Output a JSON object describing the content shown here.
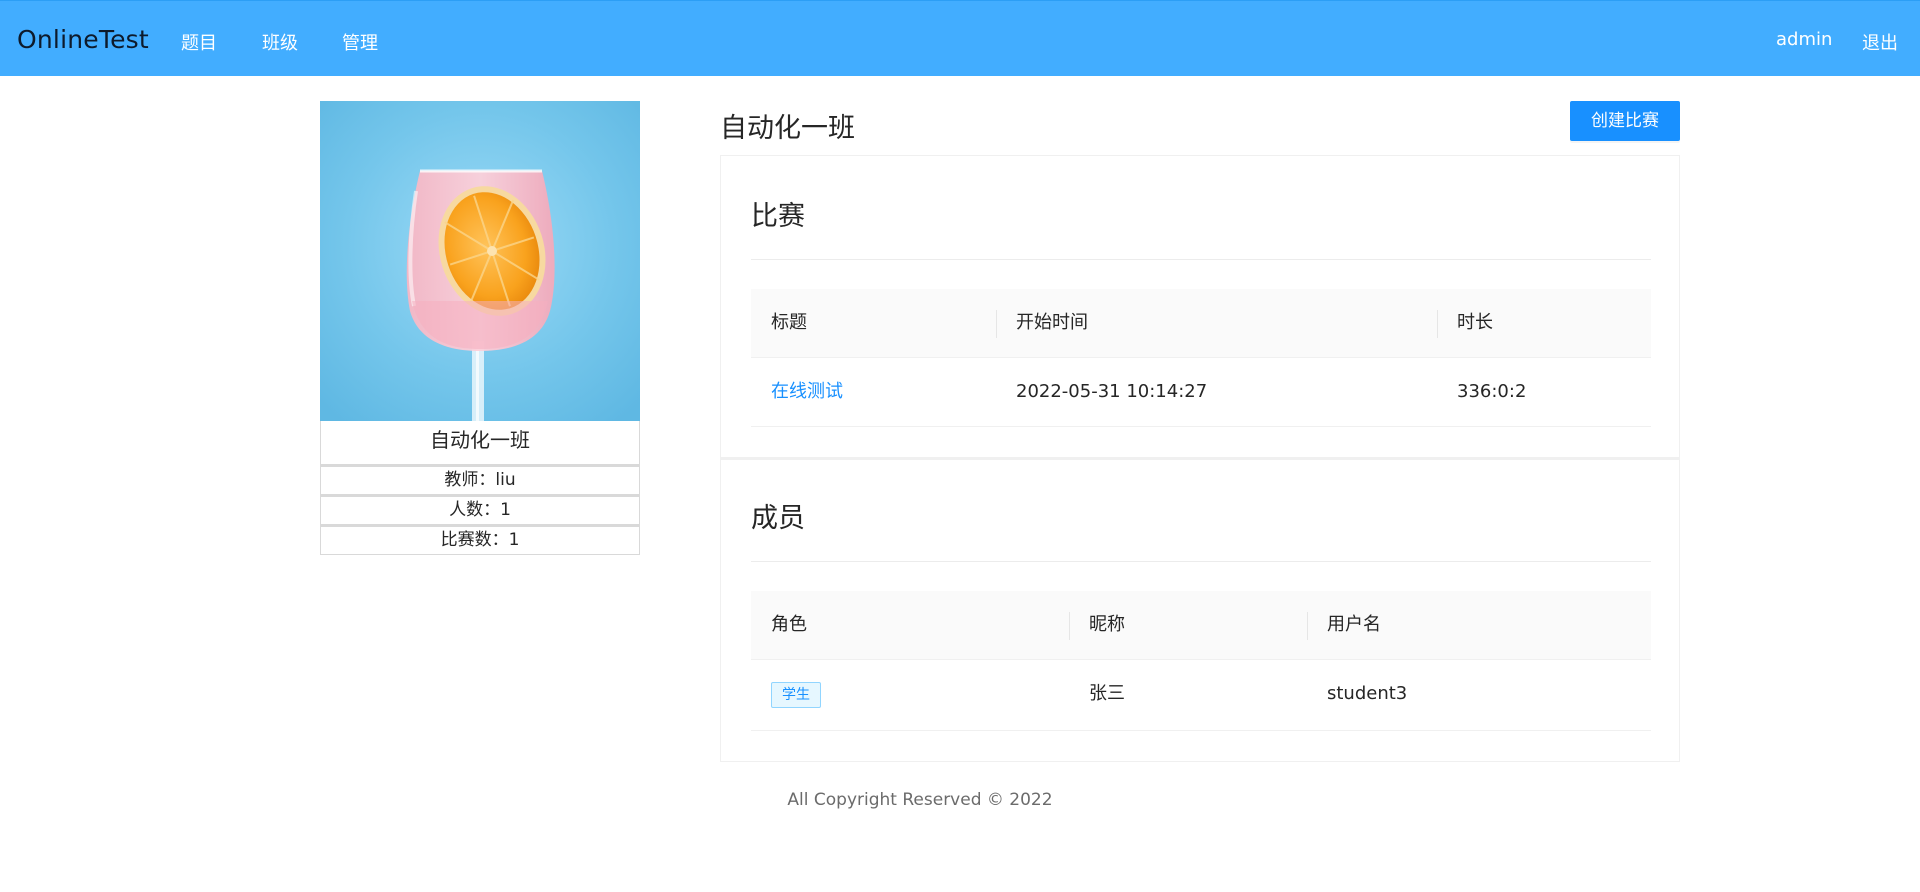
{
  "nav": {
    "brand": "OnlineTest",
    "items": [
      {
        "label": "题目"
      },
      {
        "label": "班级"
      },
      {
        "label": "管理"
      }
    ],
    "user": "admin",
    "logout": "退出"
  },
  "class_card": {
    "name": "自动化一班",
    "teacher_label": "教师：",
    "teacher": "liu",
    "members_label": "人数：",
    "members": "1",
    "contests_label": "比赛数：",
    "contests": "1"
  },
  "main": {
    "title": "自动化一班",
    "create_button": "创建比赛"
  },
  "contests": {
    "title": "比赛",
    "columns": [
      "标题",
      "开始时间",
      "时长"
    ],
    "rows": [
      {
        "title": "在线测试",
        "start_time": "2022-05-31 10:14:27",
        "duration": "336:0:2"
      }
    ]
  },
  "members": {
    "title": "成员",
    "columns": [
      "角色",
      "昵称",
      "用户名"
    ],
    "rows": [
      {
        "role": "学生",
        "nickname": "张三",
        "username": "student3"
      }
    ]
  },
  "footer": {
    "text": "All Copyright Reserved © 2022"
  },
  "colors": {
    "nav_bg": "#42adff",
    "primary": "#1890ff"
  }
}
